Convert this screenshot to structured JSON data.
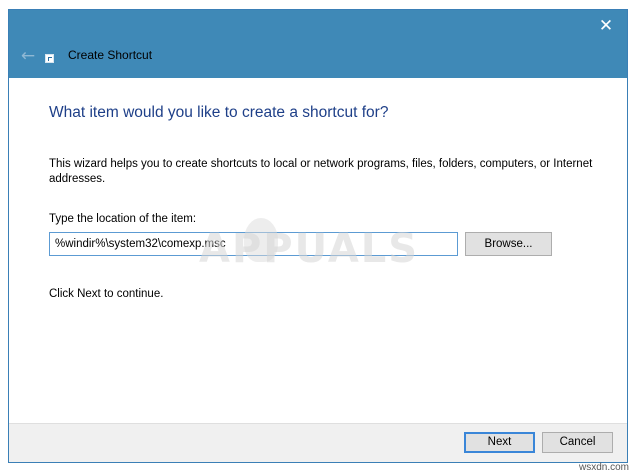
{
  "window": {
    "title": "Create Shortcut",
    "close_icon": "close-icon",
    "back_icon": "back-arrow-icon",
    "accent_color": "#3f89b7"
  },
  "content": {
    "heading": "What item would you like to create a shortcut for?",
    "description": "This wizard helps you to create shortcuts to local or network programs, files, folders, computers, or Internet addresses.",
    "location_label": "Type the location of the item:",
    "location_value": "%windir%\\system32\\comexp.msc",
    "browse_label": "Browse...",
    "hint": "Click Next to continue.",
    "watermark": "APPUALS"
  },
  "footer": {
    "next_label": "Next",
    "cancel_label": "Cancel"
  },
  "site_mark": "wsxdn.com"
}
